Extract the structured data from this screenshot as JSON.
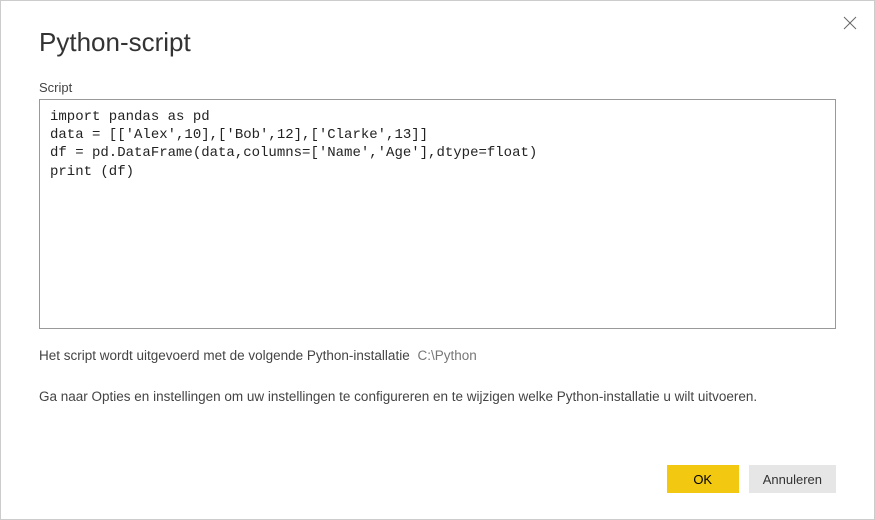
{
  "dialog": {
    "title": "Python-script",
    "script_label": "Script",
    "script_value": "import pandas as pd\ndata = [['Alex',10],['Bob',12],['Clarke',13]]\ndf = pd.DataFrame(data,columns=['Name','Age'],dtype=float)\nprint (df)",
    "install_note_prefix": "Het script wordt uitgevoerd met de volgende Python-installatie",
    "install_path": "C:\\Python",
    "options_note": "Ga naar Opties en instellingen om uw instellingen te configureren en te wijzigen welke Python-installatie u wilt uitvoeren.",
    "buttons": {
      "ok": "OK",
      "cancel": "Annuleren"
    }
  }
}
